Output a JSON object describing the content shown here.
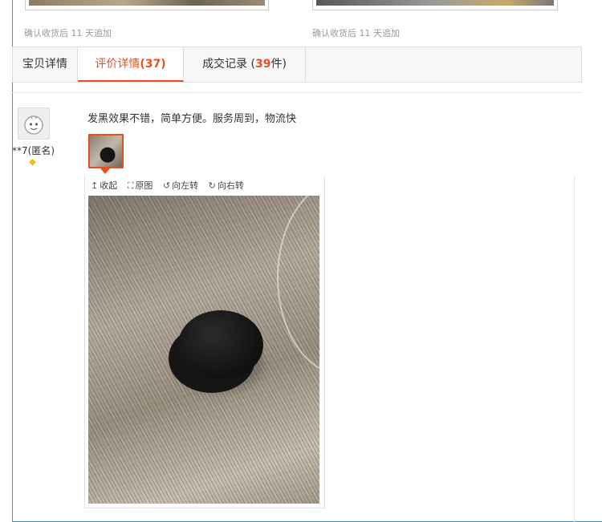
{
  "cards": {
    "confirm_left": "确认收货后 11 天追加",
    "confirm_right": "确认收货后 11 天追加"
  },
  "tabs": {
    "detail": "宝贝详情",
    "reviews_label": "评价详情",
    "reviews_count": "(37)",
    "deals_prefix": "成交记录 (",
    "deals_count": "39",
    "deals_suffix": "件)"
  },
  "review": {
    "user": "**7(匿名)",
    "text": "发黑效果不错，简单方便。服务周到，物流快"
  },
  "viewer": {
    "collapse": "收起",
    "original": "原图",
    "rotate_left": "向左转",
    "rotate_right": "向右转"
  },
  "colors": {
    "accent": "#e4531f",
    "frame": "#4a90c8"
  }
}
